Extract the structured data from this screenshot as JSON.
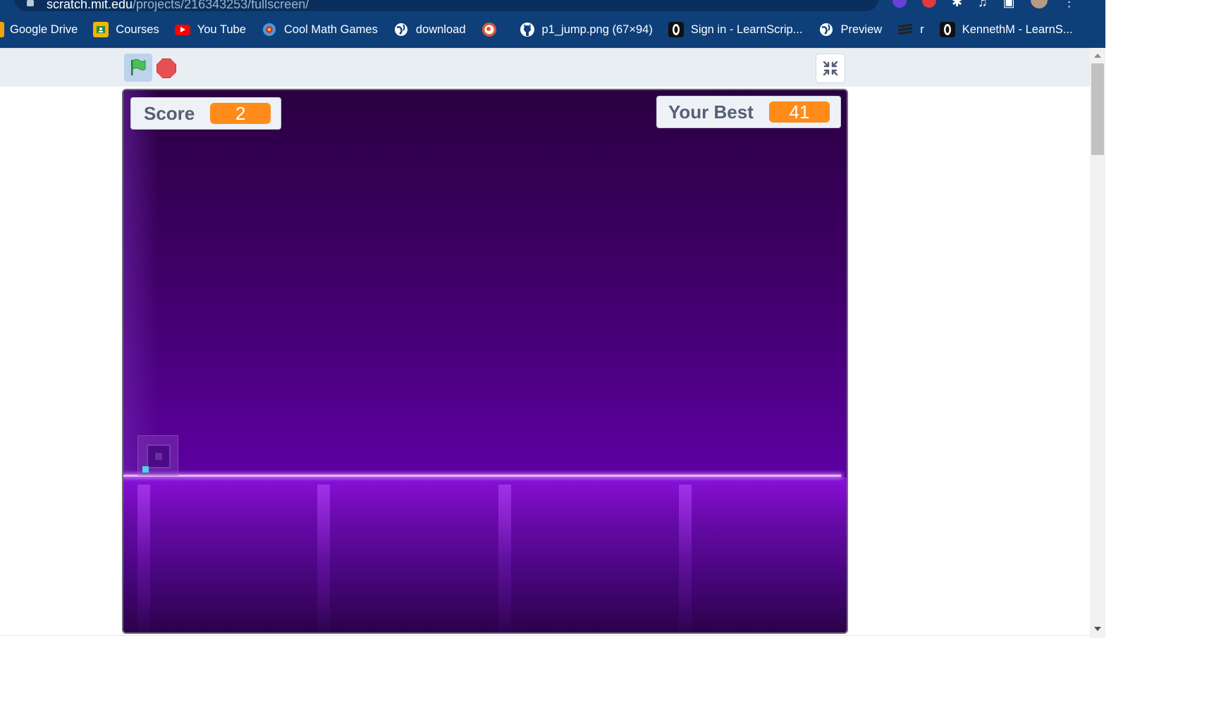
{
  "browser": {
    "url_host": "scratch.mit.edu",
    "url_path": "/projects/216343253/fullscreen/",
    "bookmarks": [
      {
        "label": "Google Drive",
        "icon": "google-drive-icon",
        "color": "#f1a30b"
      },
      {
        "label": "Courses",
        "icon": "google-classroom-icon",
        "color": "#f3b400"
      },
      {
        "label": "You Tube",
        "icon": "youtube-icon",
        "color": "#ff0000"
      },
      {
        "label": "Cool Math Games",
        "icon": "coolmath-icon",
        "color": "#3aa0e8"
      },
      {
        "label": "download",
        "icon": "globe-icon",
        "color": "#ffffff"
      },
      {
        "label": "",
        "icon": "duckduckgo-icon",
        "color": "#de5833"
      },
      {
        "label": "p1_jump.png (67×94)",
        "icon": "github-icon",
        "color": "#ffffff"
      },
      {
        "label": "Sign in - LearnScrip...",
        "icon": "learnscripture-icon",
        "color": "#ffffff"
      },
      {
        "label": "Preview",
        "icon": "globe-icon",
        "color": "#ffffff"
      },
      {
        "label": "r",
        "icon": "stripes-icon",
        "color": "#333333"
      },
      {
        "label": "KennethM - LearnS...",
        "icon": "learnscripture-icon",
        "color": "#ffffff"
      }
    ]
  },
  "scratch": {
    "score": {
      "label": "Score",
      "value": "2"
    },
    "best": {
      "label": "Your Best",
      "value": "41"
    },
    "colors": {
      "monitor_value": "#ff8c1a",
      "stage_top": "#2b0042",
      "stage_bottom": "#7a06d1",
      "player": "#47d7e6"
    }
  }
}
